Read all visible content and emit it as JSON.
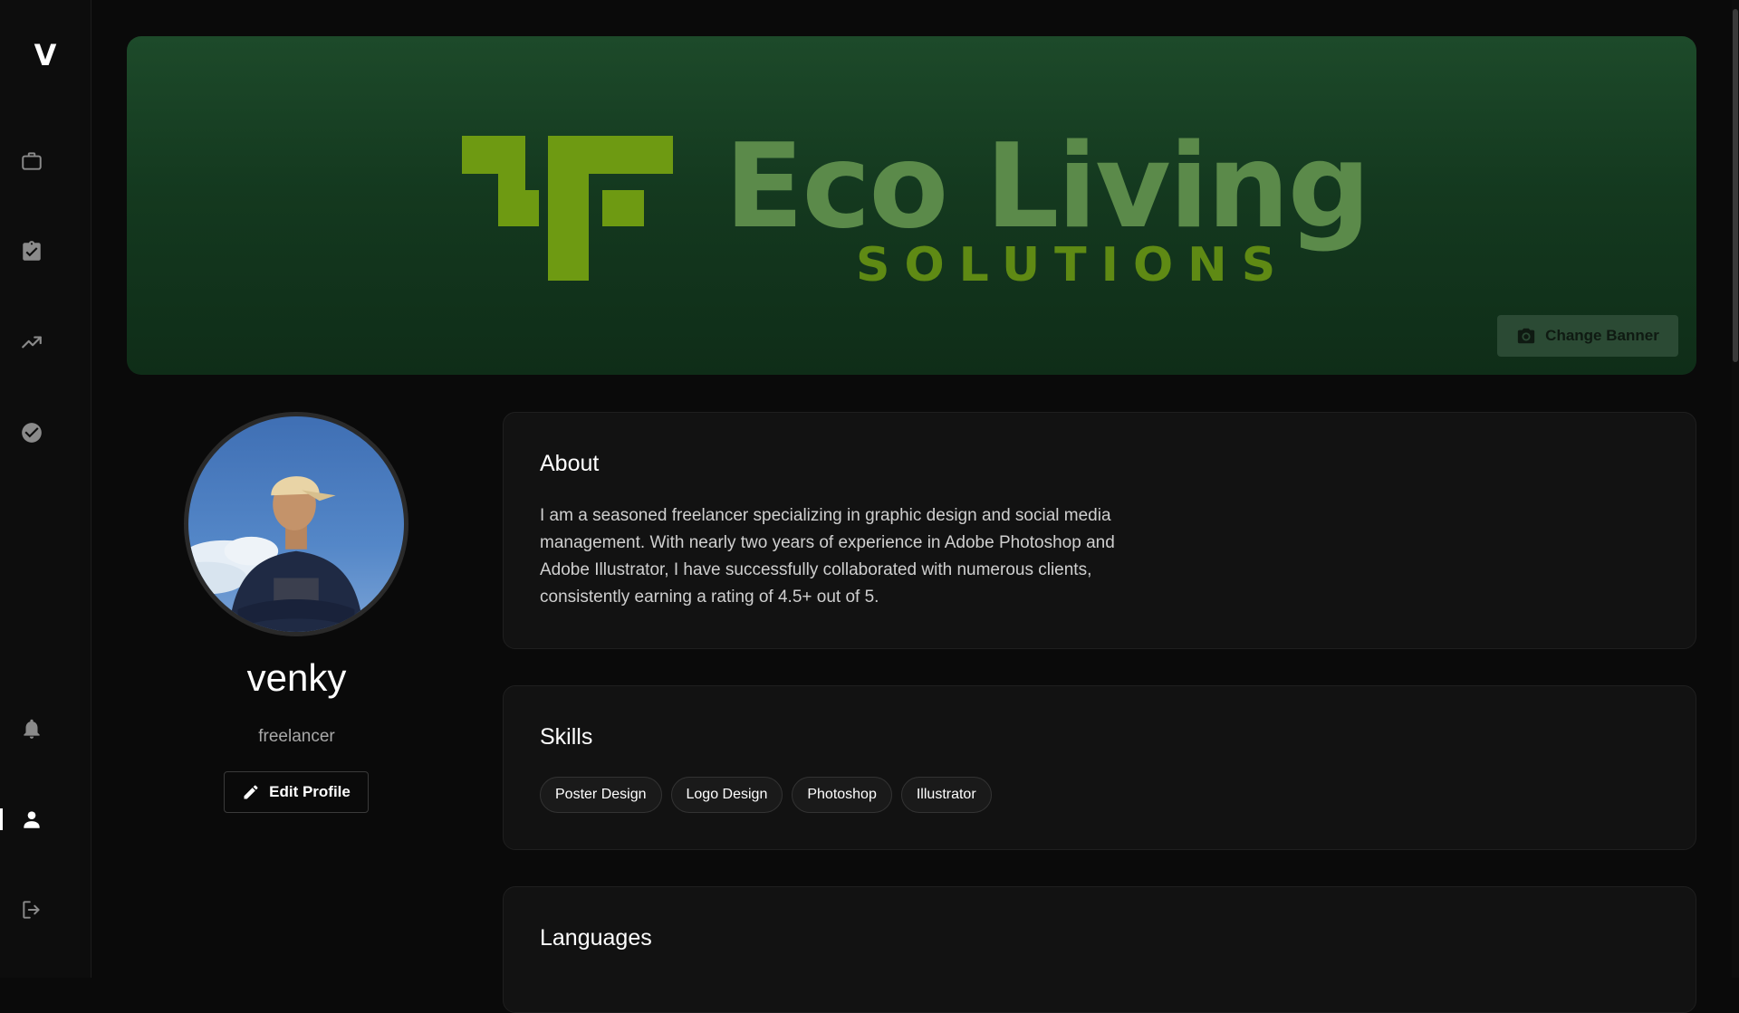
{
  "sidebar": {
    "logo": "V",
    "items": [
      {
        "name": "jobs",
        "icon": "briefcase-icon"
      },
      {
        "name": "tasks",
        "icon": "clipboard-check-icon"
      },
      {
        "name": "analytics",
        "icon": "trending-up-icon"
      },
      {
        "name": "completed",
        "icon": "check-circle-icon"
      },
      {
        "name": "notifications",
        "icon": "bell-icon"
      },
      {
        "name": "profile",
        "icon": "person-icon",
        "active": true
      },
      {
        "name": "logout",
        "icon": "logout-icon"
      }
    ]
  },
  "banner": {
    "brand_name": "Eco Living",
    "brand_tagline": "SOLUTIONS",
    "change_banner_label": "Change Banner",
    "change_banner_icon": "camera-icon"
  },
  "profile": {
    "name": "venky",
    "role": "freelancer",
    "edit_label": "Edit Profile",
    "edit_icon": "pencil-icon"
  },
  "about": {
    "title": "About",
    "text": "I am a seasoned freelancer specializing in graphic design and social media management. With nearly two years of experience in Adobe Photoshop and Adobe Illustrator, I have successfully collaborated with numerous clients, consistently earning a rating of 4.5+ out of 5."
  },
  "skills": {
    "title": "Skills",
    "items": [
      "Poster Design",
      "Logo Design",
      "Photoshop",
      "Illustrator"
    ]
  },
  "languages": {
    "title": "Languages"
  },
  "colors": {
    "background": "#0a0a0a",
    "card": "#121212",
    "banner_green": "#1d4a2a",
    "logo_mark": "#6e9a12",
    "logo_text": "#5b8a4a"
  }
}
